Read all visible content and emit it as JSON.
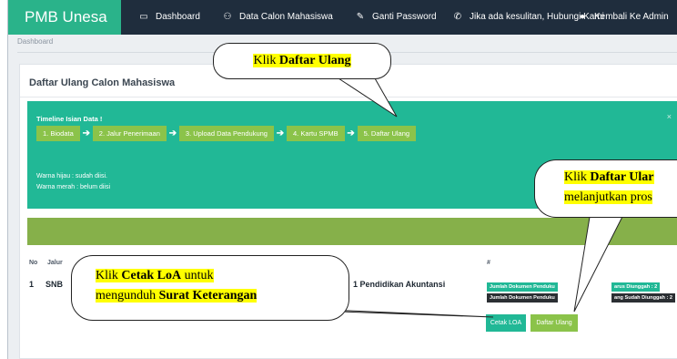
{
  "nav": {
    "brand": "PMB Unesa",
    "items": [
      {
        "icon": "monitor-icon",
        "label": "Dashboard"
      },
      {
        "icon": "users-icon",
        "label": "Data Calon Mahasiswa"
      },
      {
        "icon": "pencil-icon",
        "label": "Ganti Password"
      },
      {
        "icon": "phone-icon",
        "label": "Jika ada kesulitan, Hubungi Kami"
      },
      {
        "icon": "user-icon",
        "label": "Kembali Ke Admin"
      }
    ]
  },
  "breadcrumb": "Dashboard",
  "page_title": "Daftar Ulang Calon Mahasiswa",
  "timeline": {
    "title": "Timeline Isian Data !",
    "close": "×",
    "steps": [
      "1. Biodata",
      "2. Jalur Penerimaan",
      "3. Upload Data Pendukung",
      "4. Kartu SPMB",
      "5. Daftar Ulang"
    ],
    "arrow": "➔",
    "legend_green": "Warna hijau : sudah diisi.",
    "legend_red": "Warna merah : belum diisi"
  },
  "table": {
    "headers": {
      "no": "No",
      "jalur": "Jalur",
      "hash": "#"
    },
    "row": {
      "no": "1",
      "jalur": "SNB",
      "prodi": "1 Pendidikan Akuntansi",
      "doc_badge_1": "Jumlah Dokumen Penduku",
      "doc_badge_1b": "arus Diunggah : 2",
      "doc_badge_2": "Jumlah Dokumen Penduku",
      "doc_badge_2b": "ang Sudah Diunggah : 2",
      "btn_cetak": "Cetak LOA",
      "btn_daftar": "Daftar Ulang"
    }
  },
  "callouts": {
    "c1_pre": "Klik ",
    "c1_bold": "Daftar Ulang",
    "c2_pre": "Klik ",
    "c2_bold": "Daftar Ular",
    "c2_line2": "melanjutkan pros",
    "c3_pre": "Klik ",
    "c3_bold": "Cetak LoA",
    "c3_post": " untuk",
    "c3_line2_pre": "mengunduh ",
    "c3_line2_bold": "Surat Keterangan"
  },
  "colors": {
    "nav_bg": "#1f2d3d",
    "brand": "#2ab38a",
    "timeline": "#21b896",
    "step": "#8bc34a",
    "greenbar": "#86b04a",
    "badge_green": "#21b896",
    "badge_dark": "#2b2f33",
    "btn_cetak": "#21b896",
    "btn_daftar": "#8bc34a",
    "highlight": "#ffff00"
  }
}
